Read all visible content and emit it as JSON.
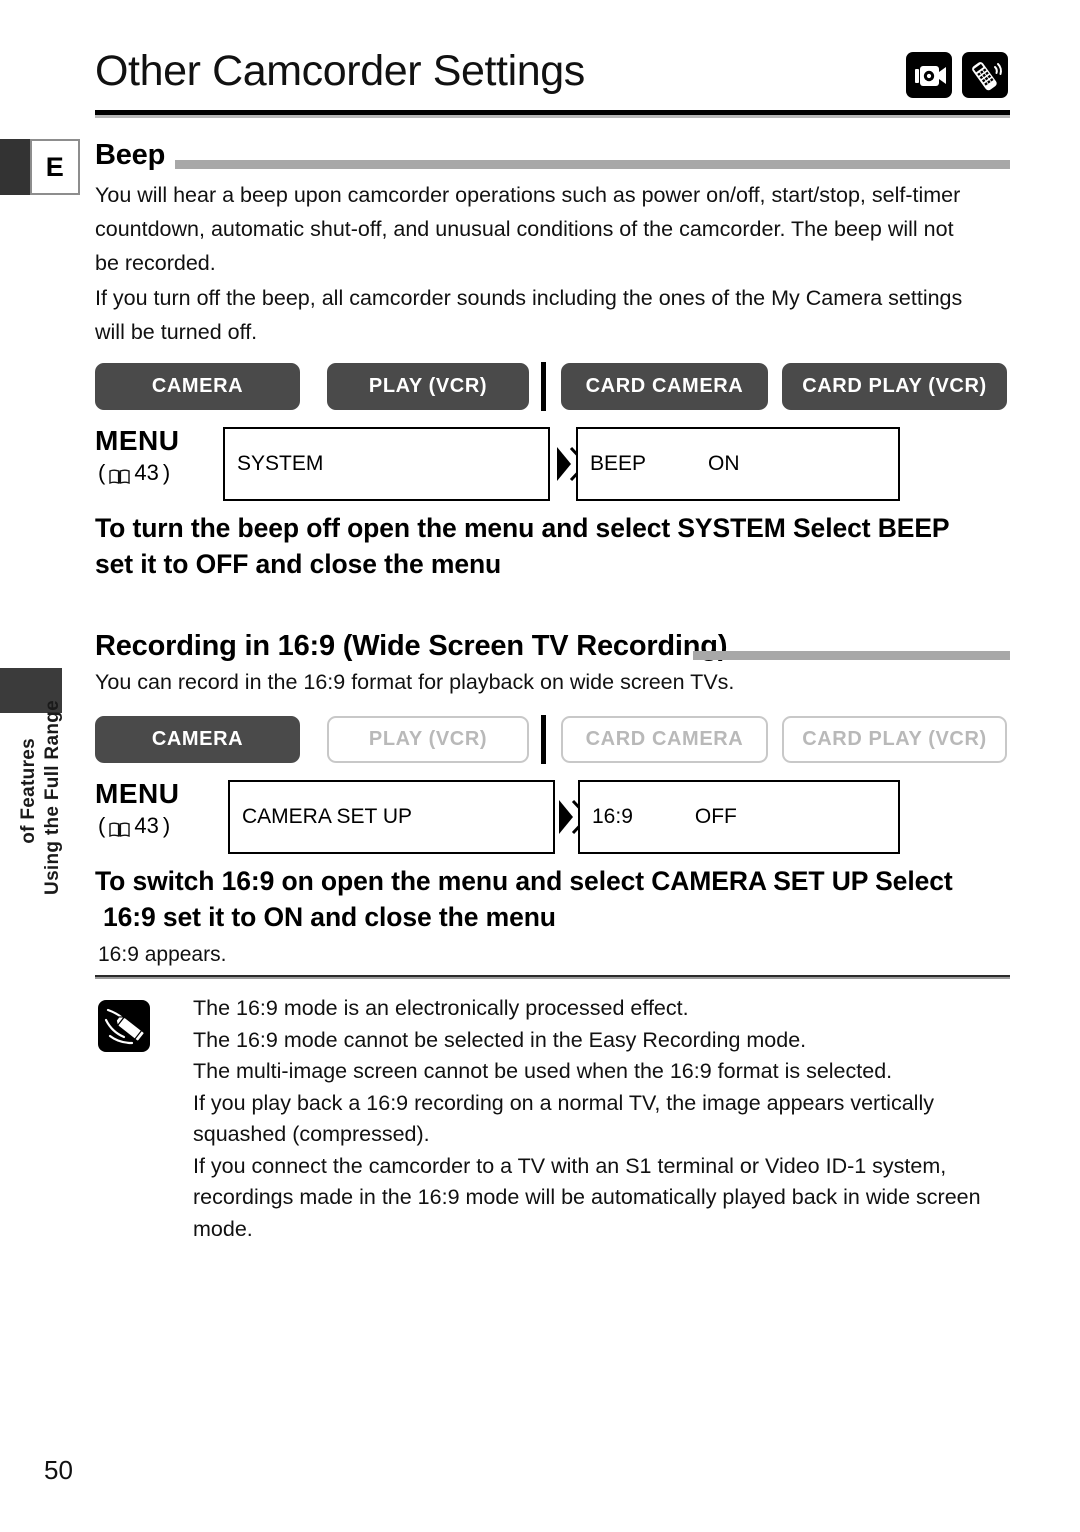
{
  "page": {
    "title": "Other Camcorder Settings",
    "number": "50",
    "edge_tab": "E",
    "sidebar_line1": "Using the Full Range",
    "sidebar_line2": "of Features"
  },
  "header_icons": [
    {
      "name": "camcorder-icon"
    },
    {
      "name": "remote-control-icon"
    }
  ],
  "beep": {
    "heading": "Beep",
    "paragraph1": "You will hear a beep upon camcorder operations such as power on/off, start/stop, self-timer countdown, automatic shut-off, and unusual conditions of the camcorder. The beep will not be recorded.",
    "paragraph2": "If you turn off the beep, all camcorder sounds including the ones of the My Camera settings will be turned off.",
    "modes": [
      {
        "label": "CAMERA",
        "state": "on"
      },
      {
        "label": "PLAY (VCR)",
        "state": "on"
      },
      {
        "label": "CARD CAMERA",
        "state": "on"
      },
      {
        "label": "CARD PLAY (VCR)",
        "state": "on"
      }
    ],
    "menu": {
      "label": "MENU",
      "page_ref": "43",
      "page_ref_open": "(",
      "page_ref_close": ")",
      "box1": "SYSTEM",
      "box2_name": "BEEP",
      "box2_value": "ON"
    },
    "instruction_line1": "To turn the beep off  open the menu and select  SYSTEM   Select  BEEP",
    "instruction_line2": "set it to  OFF  and close the menu"
  },
  "widescreen": {
    "heading": "Recording in 16:9 (Wide Screen TV Recording)",
    "paragraph1": "You can record in the 16:9 format for playback on wide screen TVs.",
    "modes": [
      {
        "label": "CAMERA",
        "state": "on"
      },
      {
        "label": "PLAY (VCR)",
        "state": "off"
      },
      {
        "label": "CARD CAMERA",
        "state": "off"
      },
      {
        "label": "CARD PLAY (VCR)",
        "state": "off"
      }
    ],
    "menu": {
      "label": "MENU",
      "page_ref": "43",
      "page_ref_open": "(",
      "page_ref_close": ")",
      "box1": "CAMERA SET UP",
      "box2_name": "16:9",
      "box2_value": "OFF"
    },
    "instruction_line1": "To switch 16:9 on  open the menu and select  CAMERA SET UP   Select",
    "instruction_line2": "16:9  set it to  ON  and close the menu",
    "appears_text": "16:9  appears."
  },
  "notes": {
    "icon": "note-pencil-icon",
    "items": [
      "The 16:9 mode is an electronically processed effect.",
      "The 16:9 mode cannot be selected in the Easy Recording mode.",
      "The multi-image screen cannot be used when the 16:9 format is selected.",
      "If you play back a 16:9 recording on a normal TV, the image appears vertically  squashed  (compressed).",
      "If you connect the camcorder to a TV with an S1 terminal or Video ID-1 system, recordings made in the 16:9 mode will be automatically played back in wide screen mode."
    ]
  },
  "colors": {
    "rule_dark": "#000000",
    "rule_light": "#b8b8b8",
    "mode_on_bg": "#4a4a4a",
    "mode_off_border": "#c8c8c8",
    "section_rule": "#a8a8a8"
  }
}
